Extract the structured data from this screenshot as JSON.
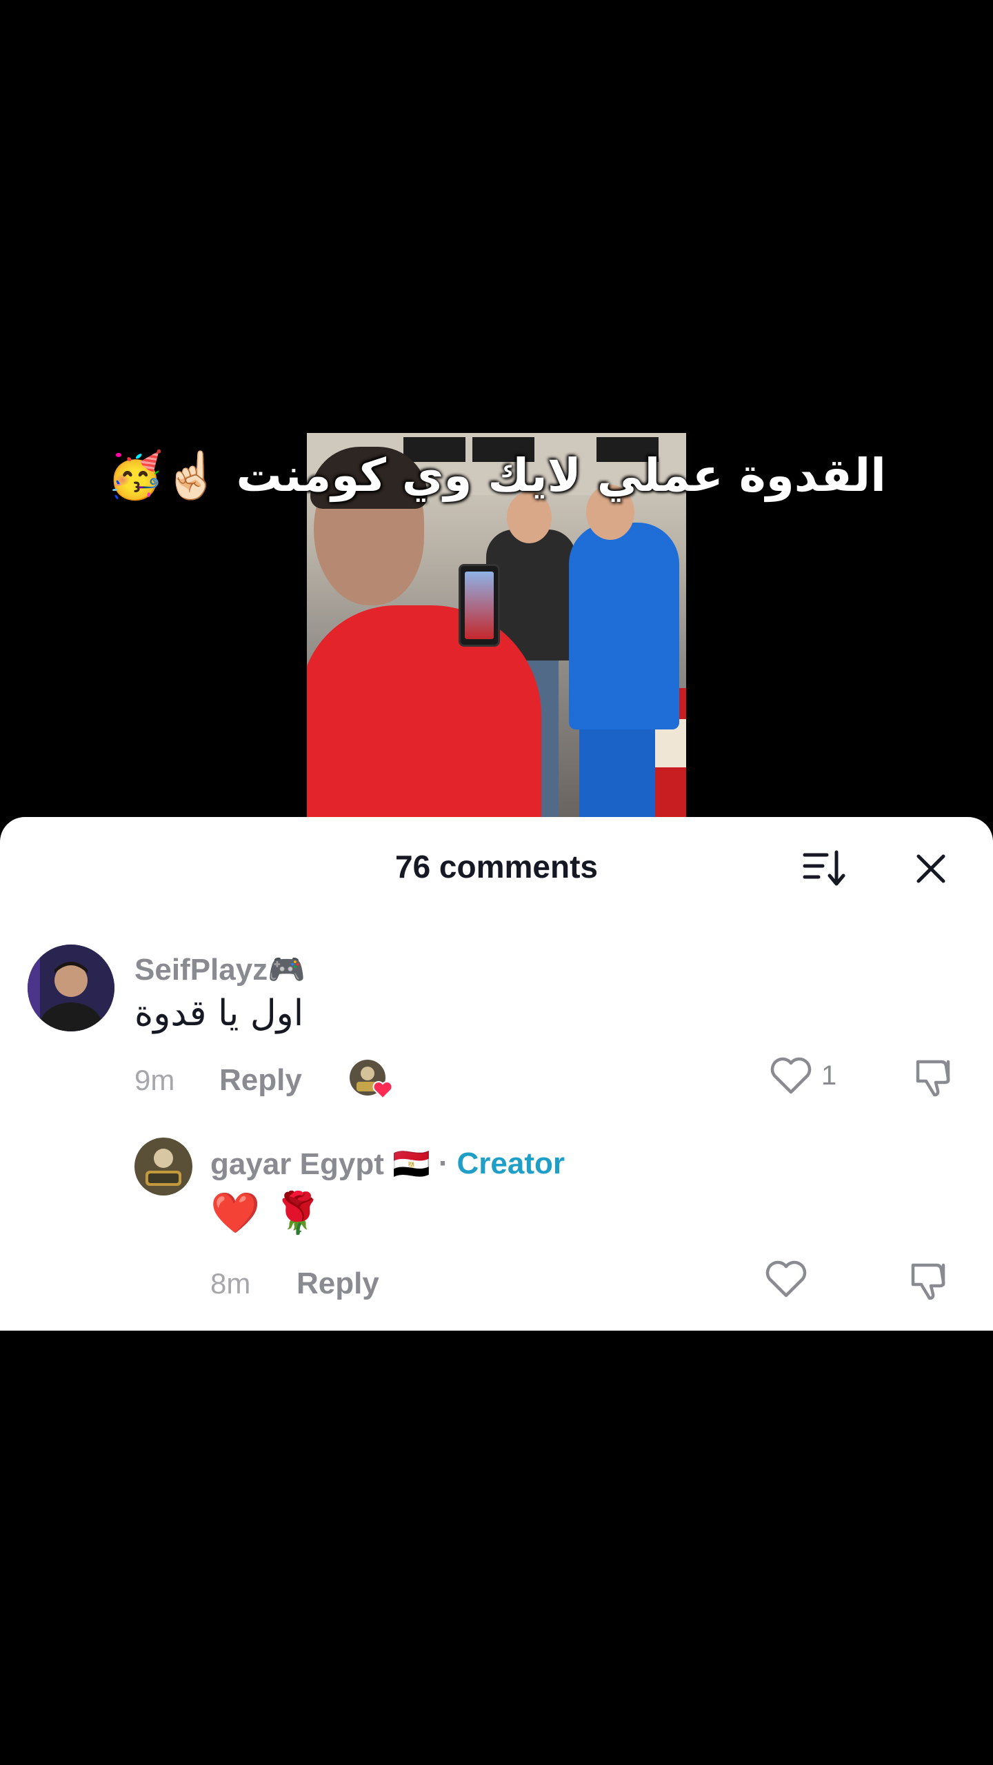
{
  "video": {
    "caption": "القدوة عملي لايك وي كومنت ☝🏻🥳"
  },
  "comments_sheet": {
    "title": "76 comments",
    "sort_icon": "sort-descending-icon",
    "close_icon": "close-icon"
  },
  "comments": [
    {
      "username": "SeifPlayz🎮",
      "text": "اول يا قدوة",
      "time": "9m",
      "reply_label": "Reply",
      "creator_liked": true,
      "like_count": "1"
    }
  ],
  "replies": [
    {
      "username": "gayar Egypt 🇪🇬",
      "separator": "·",
      "badge": "Creator",
      "text": "❤️ 🌹",
      "time": "8m",
      "reply_label": "Reply"
    }
  ],
  "colors": {
    "creator_badge": "#1f9fc8",
    "like_heart_overlay": "#fe2c55"
  }
}
